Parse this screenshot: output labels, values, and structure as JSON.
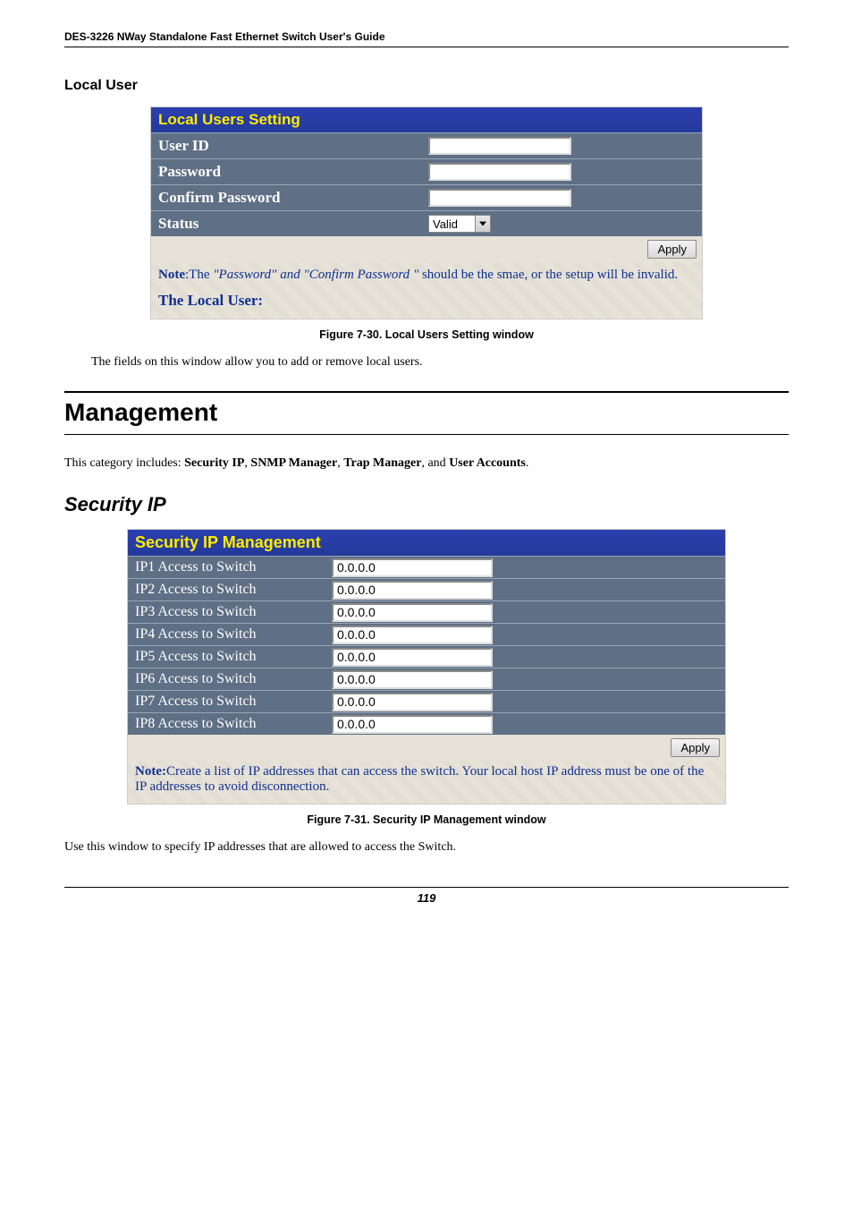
{
  "header": {
    "title": "DES-3226 NWay Standalone Fast Ethernet Switch User's Guide"
  },
  "section_local_user": "Local User",
  "panel1": {
    "title": "Local Users Setting",
    "rows": {
      "user_id": "User ID",
      "password": "Password",
      "confirm": "Confirm Password",
      "status": "Status",
      "status_value": "Valid"
    },
    "apply": "Apply",
    "note_prefix": "Note",
    "note_sep": ":",
    "note_text1": "The ",
    "note_italic": "\"Password\" and \"Confirm Password \"",
    "note_text2": " should be the smae, or the setup will be invalid.",
    "local_user_heading": "The Local User:"
  },
  "fig1": "Figure 7-30.  Local Users Setting window",
  "body1": "The fields on this window allow you to add or remove local users.",
  "heading_management": "Management",
  "body2_pre": "This category includes: ",
  "body2_items": [
    "Security IP",
    "SNMP Manager",
    "Trap Manager",
    "User Accounts"
  ],
  "body2_sep": ", ",
  "body2_and": ", and ",
  "body2_post": ".",
  "heading_security_ip": "Security IP",
  "panel2": {
    "title": "Security IP Management",
    "rows": [
      {
        "label": "IP1 Access to Switch",
        "value": "0.0.0.0"
      },
      {
        "label": "IP2 Access to Switch",
        "value": "0.0.0.0"
      },
      {
        "label": "IP3 Access to Switch",
        "value": "0.0.0.0"
      },
      {
        "label": "IP4 Access to Switch",
        "value": "0.0.0.0"
      },
      {
        "label": "IP5 Access to Switch",
        "value": "0.0.0.0"
      },
      {
        "label": "IP6 Access to Switch",
        "value": "0.0.0.0"
      },
      {
        "label": "IP7 Access to Switch",
        "value": "0.0.0.0"
      },
      {
        "label": "IP8 Access to Switch",
        "value": "0.0.0.0"
      }
    ],
    "apply": "Apply",
    "note_prefix": "Note:",
    "note_text": "Create a list of IP addresses that can access the switch.  Your local host IP address must be one of the IP addresses to avoid disconnection."
  },
  "fig2": "Figure 7-31.  Security IP Management window",
  "body3": "Use this window to specify IP addresses that are allowed to access the Switch.",
  "page_number": "119"
}
